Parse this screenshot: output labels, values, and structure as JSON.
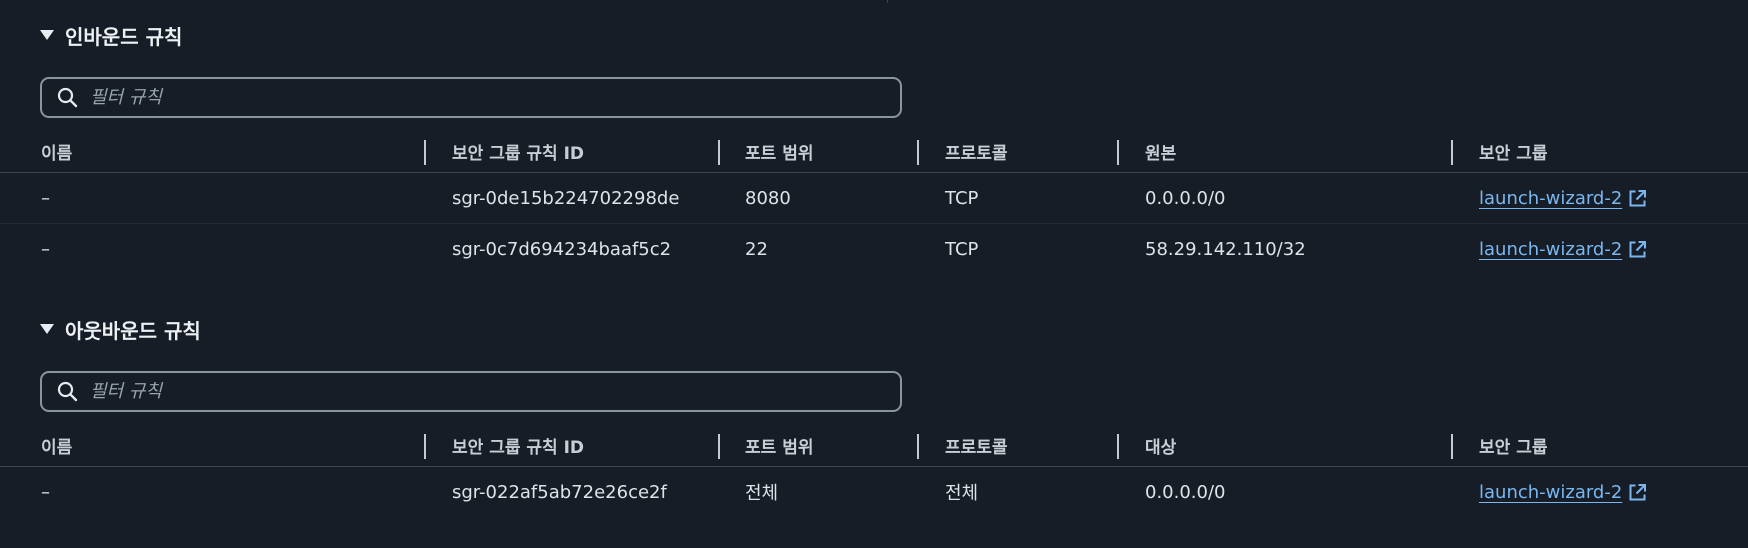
{
  "inbound": {
    "title": "인바운드 규칙",
    "filter_placeholder": "필터 규칙",
    "columns": [
      "이름",
      "보안 그룹 규칙 ID",
      "포트 범위",
      "프로토콜",
      "원본",
      "보안 그룹"
    ],
    "rows": [
      {
        "name": "–",
        "rule_id": "sgr-0de15b224702298de",
        "port": "8080",
        "protocol": "TCP",
        "source": "0.0.0.0/0",
        "group": "launch-wizard-2"
      },
      {
        "name": "–",
        "rule_id": "sgr-0c7d694234baaf5c2",
        "port": "22",
        "protocol": "TCP",
        "source": "58.29.142.110/32",
        "group": "launch-wizard-2"
      }
    ]
  },
  "outbound": {
    "title": "아웃바운드 규칙",
    "filter_placeholder": "필터 규칙",
    "columns": [
      "이름",
      "보안 그룹 규칙 ID",
      "포트 범위",
      "프로토콜",
      "대상",
      "보안 그룹"
    ],
    "rows": [
      {
        "name": "–",
        "rule_id": "sgr-022af5ab72e26ce2f",
        "port": "전체",
        "protocol": "전체",
        "source": "0.0.0.0/0",
        "group": "launch-wizard-2"
      }
    ]
  },
  "icons": {
    "caret": "caret-down-icon",
    "search": "search-icon",
    "external": "external-link-icon"
  },
  "colors": {
    "background": "#161d26",
    "link": "#79b7f0",
    "text": "#dfe3e8",
    "border": "#8a94a1"
  }
}
